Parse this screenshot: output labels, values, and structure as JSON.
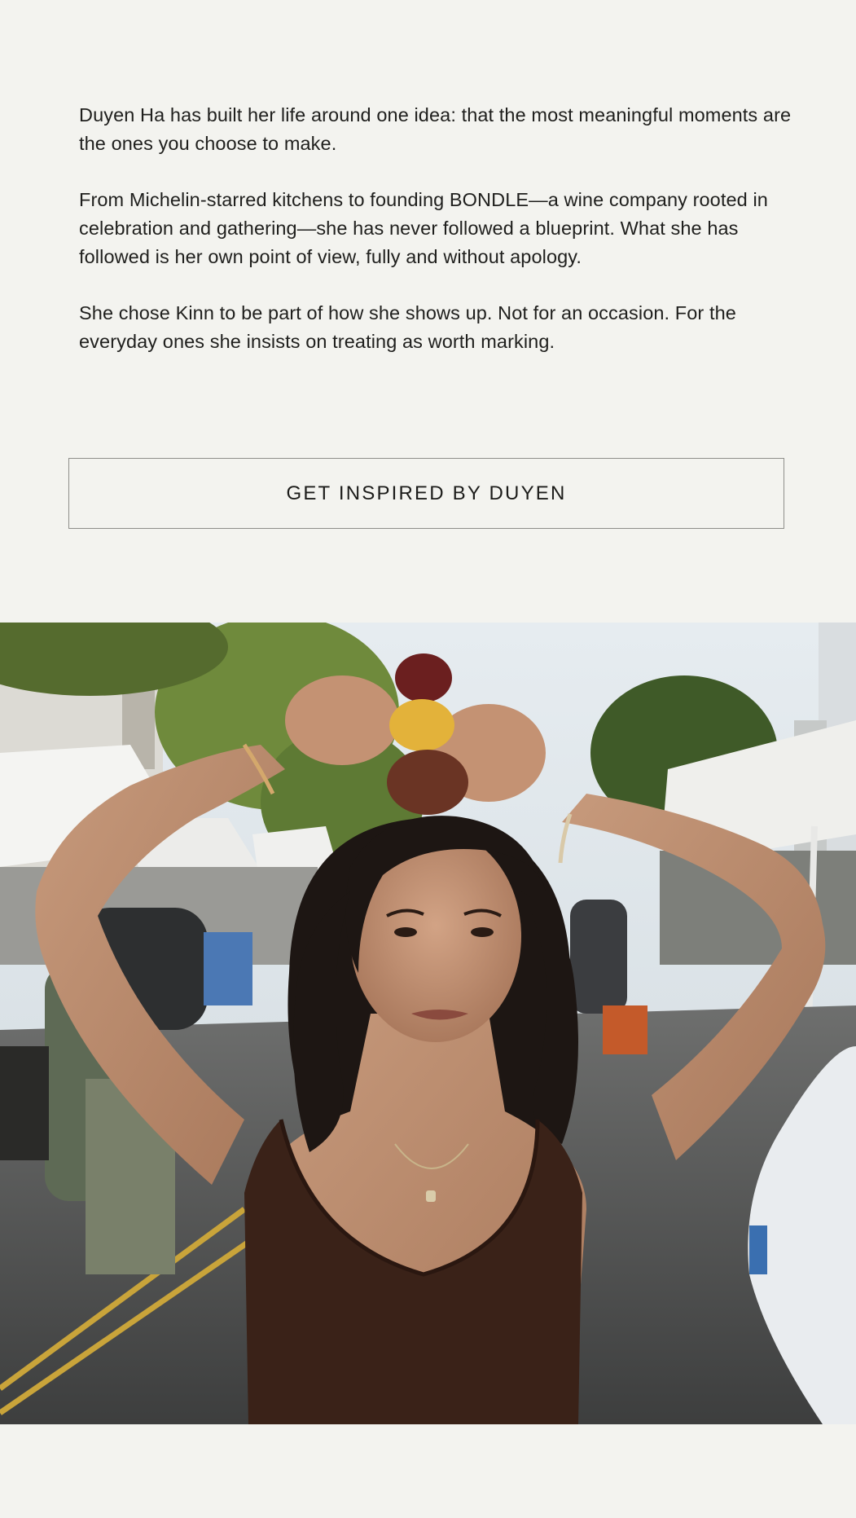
{
  "intro": {
    "paragraphs": [
      "Duyen Ha has built her life around one idea: that the most meaningful moments are the ones you choose to make.",
      "From Michelin-starred kitchens to founding BONDLE—a wine company rooted in celebration and gathering—she has never followed a blueprint. What she has followed is her own point of view, fully and without apology.",
      "She chose Kinn to be part of how she shows up. Not for an occasion. For the everyday ones she insists on treating as worth marking."
    ]
  },
  "cta": {
    "label": "GET INSPIRED BY DUYEN"
  },
  "colors": {
    "background": "#f3f3ef",
    "text": "#1c1c1a",
    "border": "#8e8e8a"
  }
}
